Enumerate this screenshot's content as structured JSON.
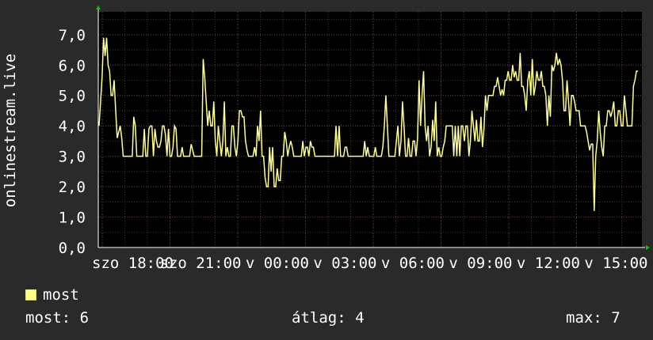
{
  "colors": {
    "background": "#2a2a2a",
    "plot_bg": "#000000",
    "grid": "#4a2f2f",
    "line": "#ffff90",
    "swatch": "#ffff80",
    "arrow": "#00cc00"
  },
  "chart_data": {
    "type": "line",
    "ylabel": "onlinestream.live",
    "ylim": [
      0,
      7.75
    ],
    "yticks": [
      "0,0",
      "1,0",
      "2,0",
      "3,0",
      "4,0",
      "5,0",
      "6,0",
      "7,0"
    ],
    "xticks": [
      "szo 18:00",
      "szo 21:00",
      "v 00:00",
      "v 03:00",
      "v 06:00",
      "v 09:00",
      "v 12:00",
      "v 15:00"
    ],
    "grid": true,
    "series": [
      {
        "name": "most",
        "values": [
          4,
          4.8,
          5.6,
          6.9,
          6.3,
          6.9,
          6,
          5.8,
          5,
          5,
          5.5,
          4.5,
          3.6,
          3.8,
          4,
          3.6,
          3,
          3,
          3,
          3,
          3,
          3,
          3,
          4.3,
          4,
          3,
          3,
          3,
          3,
          3,
          3.9,
          3,
          3,
          3.9,
          4,
          4,
          3,
          3.9,
          3.5,
          3.3,
          3.3,
          3.5,
          4,
          4,
          3.7,
          3,
          3.9,
          3,
          3,
          3.3,
          4,
          3.9,
          3,
          3,
          3,
          3.3,
          3,
          3,
          3,
          3,
          3,
          3.4,
          3.2,
          3,
          3,
          3,
          3,
          3,
          3,
          6.2,
          5.6,
          4.8,
          4,
          4.5,
          4,
          4,
          4.8,
          3.5,
          3,
          4,
          3.5,
          3,
          3.5,
          4.8,
          3,
          3.3,
          3,
          3,
          4,
          4,
          3.3,
          3,
          3.5,
          4.5,
          4.5,
          4.3,
          4.3,
          3.5,
          3.2,
          3,
          3,
          3,
          3,
          3.3,
          3,
          4,
          3.5,
          4.5,
          3,
          3,
          2.3,
          2,
          2,
          3.3,
          2.5,
          3.3,
          2,
          2,
          2.6,
          2.2,
          2.2,
          3,
          3,
          3.8,
          3.5,
          3,
          3.3,
          3.5,
          3.3,
          3,
          3,
          3,
          3,
          3,
          3,
          3.5,
          3,
          3.3,
          3.3,
          3,
          3.5,
          3.3,
          3.3,
          3,
          3,
          3,
          3,
          3,
          3,
          3,
          3,
          3,
          3,
          3,
          3,
          3,
          3,
          4,
          3,
          4,
          3,
          3,
          3,
          3.3,
          3.3,
          3,
          3,
          3,
          3,
          3,
          3,
          3,
          3,
          3,
          3,
          3,
          3.5,
          3,
          3.3,
          3,
          3,
          3,
          3,
          3.3,
          3,
          3,
          3,
          3,
          3.3,
          4,
          5,
          4,
          3,
          3,
          3,
          3,
          3,
          3.5,
          4,
          3,
          3.5,
          4.8,
          4,
          3,
          3,
          3.6,
          3,
          3,
          3.5,
          3.5,
          3,
          3.6,
          5.5,
          4,
          5,
          5.8,
          4,
          3.5,
          4,
          3,
          3.3,
          4.2,
          3.5,
          4.8,
          3,
          3.3,
          3,
          3,
          3.3,
          3.5,
          4,
          4,
          4,
          4,
          4,
          3,
          4,
          3,
          4,
          3,
          4,
          4,
          3.5,
          4,
          4,
          3,
          3.5,
          4.5,
          4,
          3.5,
          4.2,
          3.5,
          3.5,
          4.3,
          3.3,
          3.9,
          5,
          4.5,
          5,
          5,
          5,
          5,
          5.3,
          5.3,
          5.6,
          5.3,
          5,
          5.2,
          5,
          5.5,
          5.5,
          5.8,
          5.5,
          5.5,
          6,
          5.6,
          5.8,
          5.5,
          5.5,
          6.4,
          5.3,
          5.3,
          5,
          4.5,
          5.5,
          5.8,
          5,
          6.2,
          5,
          5.3,
          5.8,
          5.5,
          5.5,
          5.8,
          5.3,
          5.3,
          5,
          4,
          5,
          4.3,
          6,
          5.8,
          6,
          6.4,
          6,
          6.2,
          6,
          5.5,
          4.5,
          4.5,
          5.5,
          4.8,
          4,
          5,
          5,
          4.8,
          4.5,
          4.5,
          4.5,
          4,
          4,
          4,
          4,
          3.8,
          3.5,
          3.2,
          3.4,
          3.4,
          1.2,
          3,
          3.5,
          4.5,
          3.8,
          3.3,
          3,
          4,
          4,
          4.5,
          4.5,
          4.3,
          4.5,
          4.8,
          4,
          4,
          4.5,
          4.5,
          4,
          4,
          5,
          4.5,
          4,
          4,
          4,
          4,
          5.3,
          5.5,
          5.8,
          5.8
        ]
      }
    ]
  },
  "legend": {
    "label": "most"
  },
  "stats": {
    "most": "most: 6",
    "atlag": "átlag: 4",
    "max": "max: 7"
  }
}
